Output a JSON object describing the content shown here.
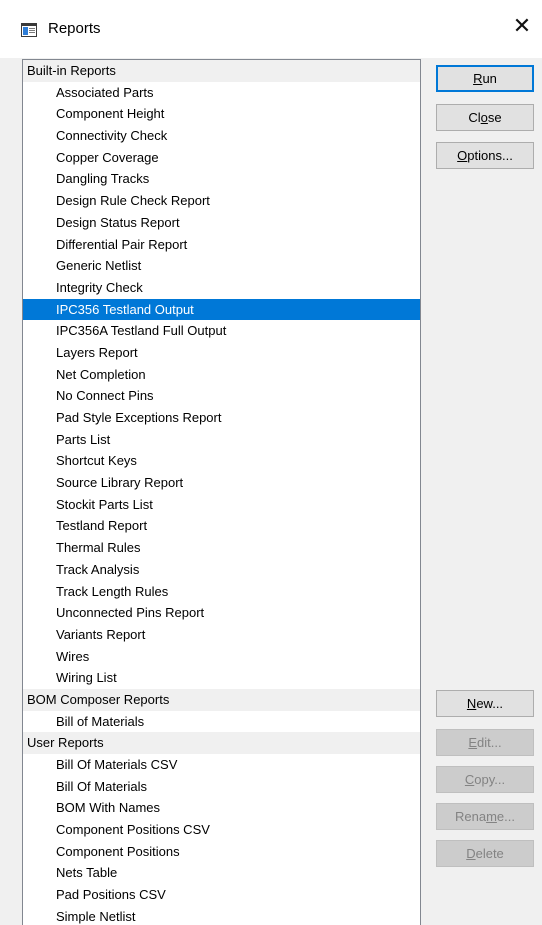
{
  "window": {
    "title": "Reports",
    "close_glyph": "✕",
    "icon": "reports-window-icon"
  },
  "list": {
    "groups": [
      {
        "label": "Built-in Reports",
        "items": [
          "Associated Parts",
          "Component Height",
          "Connectivity Check",
          "Copper Coverage",
          "Dangling Tracks",
          "Design Rule Check Report",
          "Design Status Report",
          "Differential Pair Report",
          "Generic Netlist",
          "Integrity Check",
          "IPC356 Testland Output",
          "IPC356A Testland Full Output",
          "Layers Report",
          "Net Completion",
          "No Connect Pins",
          "Pad Style Exceptions Report",
          "Parts List",
          "Shortcut Keys",
          "Source Library Report",
          "Stockit Parts List",
          "Testland Report",
          "Thermal Rules",
          "Track Analysis",
          "Track Length Rules",
          "Unconnected Pins Report",
          "Variants Report",
          "Wires",
          "Wiring List"
        ]
      },
      {
        "label": "BOM Composer Reports",
        "items": [
          "Bill of Materials"
        ]
      },
      {
        "label": "User Reports",
        "items": [
          "Bill Of Materials CSV",
          "Bill Of Materials",
          "BOM With Names",
          "Component Positions CSV",
          "Component Positions",
          "Nets Table",
          "Pad Positions CSV",
          "Simple Netlist"
        ]
      }
    ],
    "selected_item": "IPC356 Testland Output"
  },
  "buttons": {
    "run": {
      "pre": "",
      "key": "R",
      "post": "un"
    },
    "close": {
      "pre": "Cl",
      "key": "o",
      "post": "se"
    },
    "options": {
      "pre": "",
      "key": "O",
      "post": "ptions..."
    },
    "new": {
      "pre": "",
      "key": "N",
      "post": "ew..."
    },
    "edit": {
      "pre": "",
      "key": "E",
      "post": "dit..."
    },
    "copy": {
      "pre": "",
      "key": "C",
      "post": "opy..."
    },
    "rename": {
      "pre": "Rena",
      "key": "m",
      "post": "e..."
    },
    "delete": {
      "pre": "",
      "key": "D",
      "post": "elete"
    }
  },
  "colors": {
    "selection": "#0078d7",
    "group_header_bg": "#f0f0f0",
    "disabled_text": "#838383"
  }
}
